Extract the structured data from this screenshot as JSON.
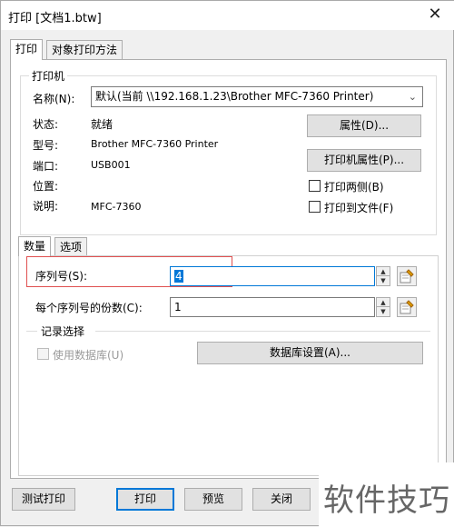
{
  "window": {
    "title": "打印 [文档1.btw]",
    "close_glyph": "✕"
  },
  "tabs": [
    {
      "label": "打印",
      "active": true
    },
    {
      "label": "对象打印方法",
      "active": false
    }
  ],
  "printer": {
    "group_title": "打印机",
    "name_label": "名称(N):",
    "name_value": "默认(当前 \\\\192.168.1.23\\Brother MFC-7360 Printer)",
    "status_label": "状态:",
    "status_value": "就绪",
    "model_label": "型号:",
    "model_value": "Brother MFC-7360 Printer",
    "port_label": "端口:",
    "port_value": "USB001",
    "location_label": "位置:",
    "location_value": "",
    "comment_label": "说明:",
    "comment_value": "MFC-7360",
    "properties_button": "属性(D)...",
    "printer_properties_button": "打印机属性(P)...",
    "duplex_label": "打印两侧(B)",
    "duplex_checked": false,
    "print_to_file_label": "打印到文件(F)",
    "print_to_file_checked": false
  },
  "inner_tabs": [
    {
      "label": "数量",
      "active": true
    },
    {
      "label": "选项",
      "active": false
    }
  ],
  "quantity": {
    "serial_label": "序列号(S):",
    "serial_value": "4",
    "copies_label": "每个序列号的份数(C):",
    "copies_value": "1",
    "records_group": "记录选择",
    "use_database_label": "使用数据库(U)",
    "use_database_checked": false,
    "database_settings_button": "数据库设置(A)..."
  },
  "footer": {
    "test_print": "测试打印",
    "print": "打印",
    "preview": "预览",
    "close": "关闭"
  },
  "watermark": {
    "text": "软件技巧"
  },
  "colors": {
    "accent": "#0078d7",
    "highlight_box": "#e05050"
  }
}
